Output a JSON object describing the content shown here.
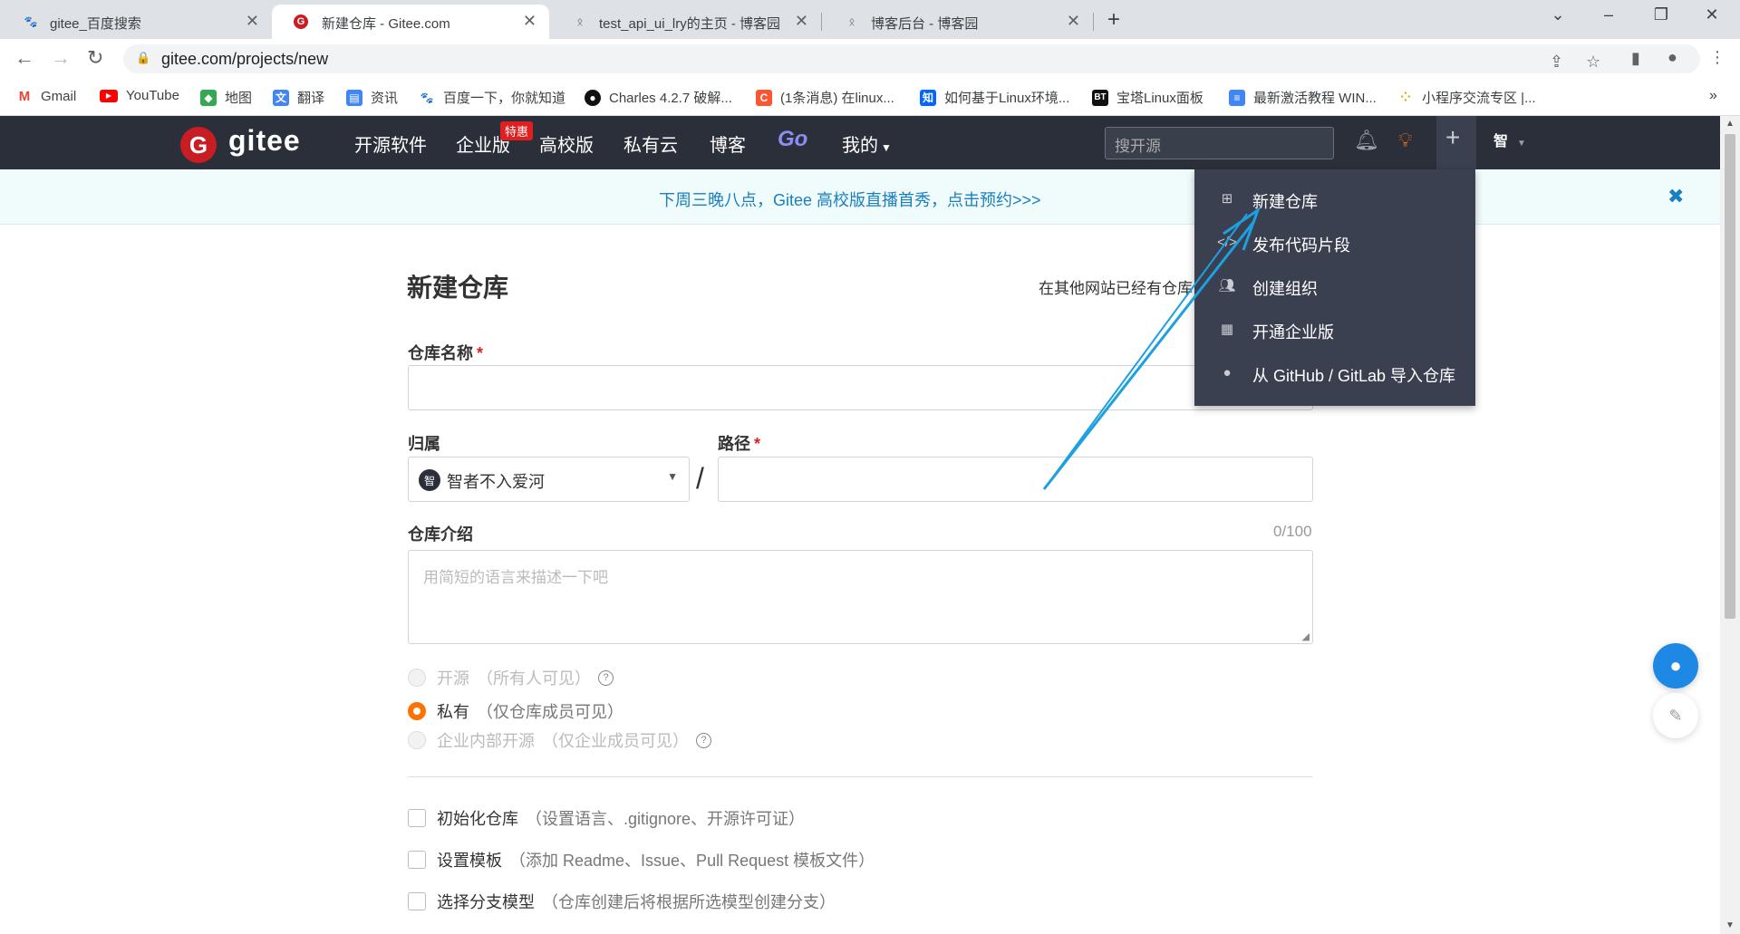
{
  "browser": {
    "tabs": [
      {
        "title": "gitee_百度搜索",
        "icon": "baidu-paw-icon"
      },
      {
        "title": "新建仓库 - Gitee.com",
        "icon": "gitee-logo-icon",
        "active": true
      },
      {
        "title": "test_api_ui_lry的主页 - 博客园",
        "icon": "cnblogs-icon"
      },
      {
        "title": "博客后台 - 博客园",
        "icon": "cnblogs-icon"
      }
    ],
    "url": "gitee.com/projects/new",
    "bookmarks": [
      {
        "label": "Gmail",
        "icon": "gmail-icon"
      },
      {
        "label": "YouTube",
        "icon": "youtube-icon"
      },
      {
        "label": "地图",
        "icon": "maps-icon"
      },
      {
        "label": "翻译",
        "icon": "translate-icon"
      },
      {
        "label": "资讯",
        "icon": "news-icon"
      },
      {
        "label": "百度一下，你就知道",
        "icon": "baidu-paw-icon"
      },
      {
        "label": "Charles 4.2.7 破解...",
        "icon": "github-icon"
      },
      {
        "label": "(1条消息) 在linux...",
        "icon": "csdn-icon"
      },
      {
        "label": "如何基于Linux环境...",
        "icon": "zhihu-icon"
      },
      {
        "label": "宝塔Linux面板",
        "icon": "bt-icon"
      },
      {
        "label": "最新激活教程 WIN...",
        "icon": "doc-icon"
      },
      {
        "label": "小程序交流专区 |...",
        "icon": "grid-icon"
      }
    ]
  },
  "gitee": {
    "logo_text": "gitee",
    "logo_letter": "G",
    "nav": [
      "开源软件",
      "企业版",
      "高校版",
      "私有云",
      "博客",
      "Go",
      "我的"
    ],
    "badge": "特惠",
    "search_placeholder": "搜开源",
    "avatar": "智",
    "notice": "下周三晚八点，Gitee 高校版直播首秀，点击预约>>>",
    "notice_close": "✖"
  },
  "dropdown": [
    {
      "label": "新建仓库",
      "icon": "plus-square-icon"
    },
    {
      "label": "发布代码片段",
      "icon": "code-icon"
    },
    {
      "label": "创建组织",
      "icon": "users-icon"
    },
    {
      "label": "开通企业版",
      "icon": "building-icon"
    },
    {
      "label": "从 GitHub / GitLab 导入仓库",
      "icon": "github-icon"
    }
  ],
  "form": {
    "title": "新建仓库",
    "import_hint": "在其他网站已经有仓库",
    "repo_name_label": "仓库名称",
    "owner_label": "归属",
    "owner_avatar": "智",
    "owner_value": "智者不入爱河",
    "path_label": "路径",
    "slash": "/",
    "desc_label": "仓库介绍",
    "desc_counter": "0/100",
    "desc_placeholder": "用简短的语言来描述一下吧",
    "required_mark": "*",
    "visibility": [
      {
        "main": "开源",
        "sub": "（所有人可见）",
        "help": true,
        "checked": false
      },
      {
        "main": "私有",
        "sub": "（仅仓库成员可见）",
        "help": false,
        "checked": true
      },
      {
        "main": "企业内部开源",
        "sub": "（仅企业成员可见）",
        "help": true,
        "checked": false
      }
    ],
    "options": [
      {
        "main": "初始化仓库",
        "sub": "（设置语言、.gitignore、开源许可证）"
      },
      {
        "main": "设置模板",
        "sub": "（添加 Readme、Issue、Pull Request 模板文件）"
      },
      {
        "main": "选择分支模型",
        "sub": "（仓库创建后将根据所选模型创建分支）"
      }
    ]
  },
  "colors": {
    "gitee_red": "#c71d23",
    "header_bg": "#2b2f3a",
    "menu_bg": "#3b4050",
    "accent_orange": "#fe7300",
    "annotation_arrow": "#1ea0e0"
  }
}
